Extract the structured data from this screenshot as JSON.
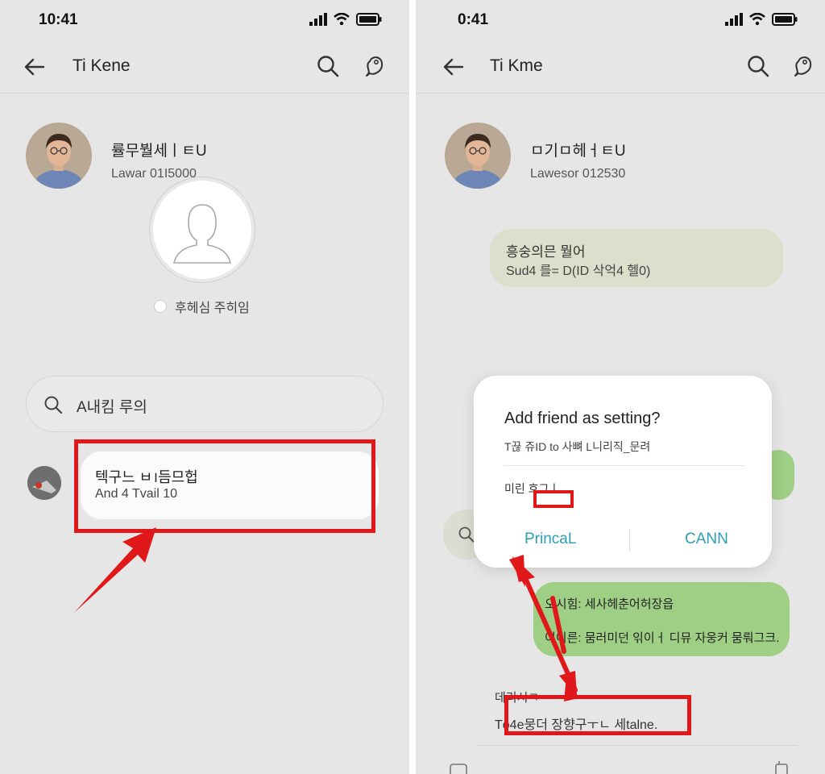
{
  "left": {
    "status_time": "10:41",
    "title": "Ti Kene",
    "contact_name": "률무붤세ㅣㅌU",
    "contact_sub": "Lawar 01I5000",
    "radio_label": "후헤심 주히임",
    "search_text": "A내킴 루의",
    "result_title": "텍구느 ㅂ।듬므헙",
    "result_sub": "And 4 Tvail 10"
  },
  "right": {
    "status_time": "0:41",
    "title": "Ti Kme",
    "contact_name": "ㅁ기ㅁ헤ㅓㅌU",
    "contact_sub": "Lawesor 012530",
    "bubble1_line1": "흥숭의믄 뭘어",
    "bubble1_line2": "Sud4 를= D(ID 삭억4 헬0)",
    "green_line1": "오시힘: 세사헤춘어허장읍",
    "green_line2": "이이른: 뭄러미던 읶이ㅓ 디뮤 자웅커 뭄뤄그크.",
    "bottom_title": "데리시ㅋ",
    "bottom_text": "Tö4e뭉더 장향구ㅜㄴ 세talne.",
    "dialog": {
      "title": "Add friend as setting?",
      "message": "T끊 쥬ID to 사뼈 L니리직_문려",
      "field_label": "미린 흐그ㅣ",
      "left_button": "PrincaL",
      "right_button": "CANN"
    }
  },
  "colors": {
    "background": "#e6e6e6",
    "highlight_red": "#e0181a",
    "accent_teal": "#2aa0b3",
    "bubble_green": "#9ecf85",
    "bubble_grey": "#dcdfcc"
  },
  "icons": [
    "back-arrow-icon",
    "search-icon",
    "chat-bubble-icon",
    "signal-icon",
    "wifi-icon",
    "battery-icon",
    "person-silhouette-icon",
    "pointer-arrow-icon"
  ]
}
